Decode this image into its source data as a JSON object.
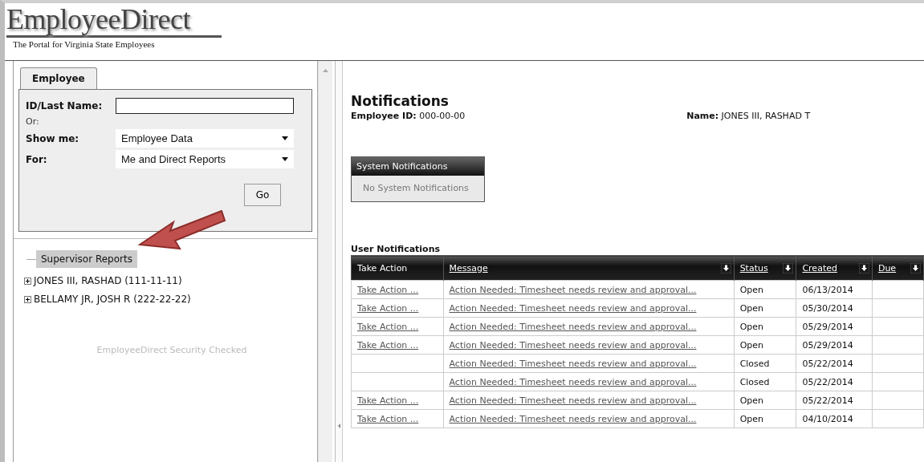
{
  "header": {
    "logo": "EmployeeDirect",
    "tagline": "The Portal for Virginia State Employees"
  },
  "search_panel": {
    "tabs": [
      {
        "label": "Employee",
        "selected": true
      }
    ],
    "id_label": "ID/Last Name:",
    "or_label": "Or:",
    "show_me_label": "Show me:",
    "show_me_value": "Employee Data",
    "for_label": "For:",
    "for_value": "Me and Direct Reports",
    "go_button": "Go"
  },
  "tree": {
    "label": "Supervisor Reports",
    "selected": true,
    "children": [
      {
        "label": "JONES III, RASHAD (111-11-11)",
        "expanded": false
      },
      {
        "label": "BELLAMY JR, JOSH R (222-22-22)",
        "expanded": false
      }
    ]
  },
  "security_note": "EmployeeDirect Security Checked",
  "notifications": {
    "title": "Notifications",
    "employee_id_label": "Employee ID:",
    "employee_id": "000-00-00",
    "name_label": "Name:",
    "name": "JONES III, RASHAD T"
  },
  "system_notifications": {
    "title": "System Notifications",
    "message": "No System Notifications"
  },
  "user_notifications": {
    "title": "User Notifications",
    "columns": [
      {
        "label": "Take Action",
        "sortable": false
      },
      {
        "label": "Message",
        "sortable": true
      },
      {
        "label": "Status",
        "sortable": true
      },
      {
        "label": "Created",
        "sortable": true
      },
      {
        "label": "Due",
        "sortable": true
      }
    ],
    "rows": [
      {
        "take_action": "Take Action ...",
        "message": "Action Needed: Timesheet needs review and approval...",
        "status": "Open",
        "created": "06/13/2014"
      },
      {
        "take_action": "Take Action ...",
        "message": "Action Needed: Timesheet needs review and approval...",
        "status": "Open",
        "created": "05/30/2014"
      },
      {
        "take_action": "Take Action ...",
        "message": "Action Needed: Timesheet needs review and approval...",
        "status": "Open",
        "created": "05/29/2014"
      },
      {
        "take_action": "Take Action ...",
        "message": "Action Needed: Timesheet needs review and approval...",
        "status": "Open",
        "created": "05/29/2014"
      },
      {
        "message": "Action Needed: Timesheet needs review and approval...",
        "status": "Closed",
        "created": "05/22/2014"
      },
      {
        "message": "Action Needed: Timesheet needs review and approval...",
        "status": "Closed",
        "created": "05/22/2014"
      },
      {
        "take_action": "Take Action ...",
        "message": "Action Needed: Timesheet needs review and approval...",
        "status": "Open",
        "created": "05/22/2014"
      },
      {
        "take_action": "Take Action ...",
        "message": "Action Needed: Timesheet needs review and approval...",
        "status": "Open",
        "created": "04/10/2014"
      }
    ]
  }
}
